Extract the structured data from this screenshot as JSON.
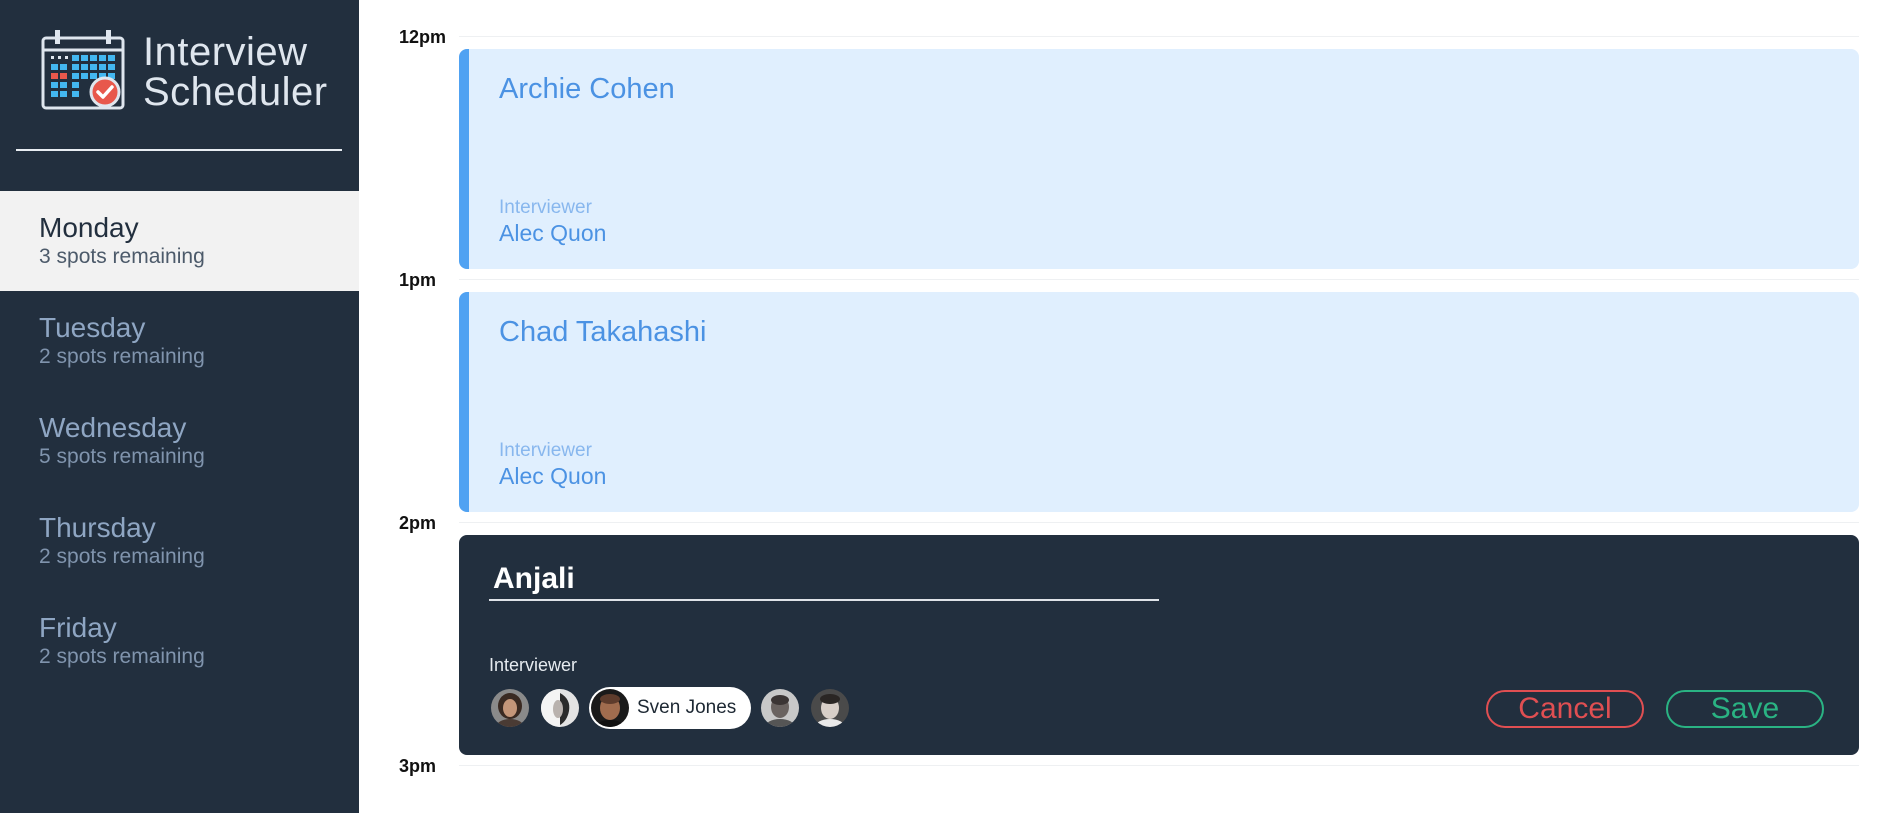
{
  "brand": {
    "line1": "Interview",
    "line2": "Scheduler",
    "logo_icon": "calendar-check-icon"
  },
  "days": [
    {
      "name": "Monday",
      "spots": "3 spots remaining",
      "selected": true
    },
    {
      "name": "Tuesday",
      "spots": "2 spots remaining",
      "selected": false
    },
    {
      "name": "Wednesday",
      "spots": "5 spots remaining",
      "selected": false
    },
    {
      "name": "Thursday",
      "spots": "2 spots remaining",
      "selected": false
    },
    {
      "name": "Friday",
      "spots": "2 spots remaining",
      "selected": false
    }
  ],
  "times": [
    "12pm",
    "1pm",
    "2pm",
    "3pm"
  ],
  "appointments": [
    {
      "student": "Archie Cohen",
      "interviewer_label": "Interviewer",
      "interviewer": "Alec Quon"
    },
    {
      "student": "Chad Takahashi",
      "interviewer_label": "Interviewer",
      "interviewer": "Alec Quon"
    }
  ],
  "form": {
    "student_value": "Anjali",
    "interviewer_label": "Interviewer",
    "selected_interviewer": "Sven Jones",
    "cancel_label": "Cancel",
    "save_label": "Save"
  },
  "colors": {
    "sidebar_bg": "#222f3e",
    "appointment_bg": "#e0effe",
    "appointment_accent": "#50a2f2",
    "cancel": "#e04f52",
    "save": "#2ab383"
  }
}
